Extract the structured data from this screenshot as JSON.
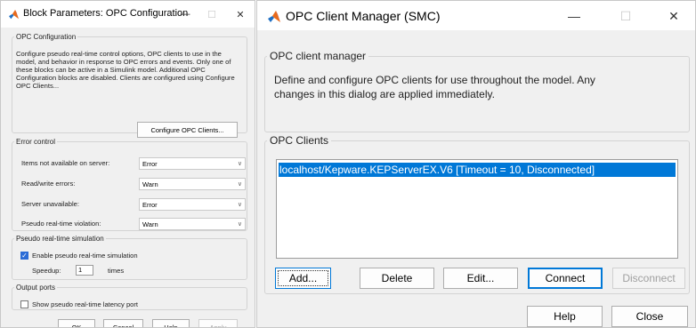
{
  "block_params": {
    "title": "Block Parameters: OPC Configuration",
    "title_controls": {
      "minimize": "—",
      "maximize": "☐",
      "close": "✕"
    },
    "opc_configuration": {
      "legend": "OPC Configuration",
      "description": "Configure pseudo real-time control options, OPC clients to use in the model, and behavior in response to OPC errors and events. Only one of these blocks can be active in a Simulink model. Additional OPC Configuration blocks are disabled. Clients are configured using Configure OPC Clients...",
      "configure_button": "Configure OPC Clients..."
    },
    "error_control": {
      "legend": "Error control",
      "rows": [
        {
          "label": "Items not available on server:",
          "value": "Error"
        },
        {
          "label": "Read/write errors:",
          "value": "Warn"
        },
        {
          "label": "Server unavailable:",
          "value": "Error"
        },
        {
          "label": "Pseudo real-time violation:",
          "value": "Warn"
        }
      ]
    },
    "pseudo_realtime": {
      "legend": "Pseudo real-time simulation",
      "enable_label": "Enable pseudo real-time simulation",
      "enable_checked": true,
      "speedup_label": "Speedup:",
      "speedup_value": "1",
      "speedup_unit": "times"
    },
    "output_ports": {
      "legend": "Output ports",
      "latency_label": "Show pseudo real-time latency port",
      "latency_checked": false
    },
    "buttons": {
      "ok": "OK",
      "cancel": "Cancel",
      "help": "Help",
      "apply": "Apply"
    }
  },
  "client_manager": {
    "title": "OPC Client Manager (SMC)",
    "title_controls": {
      "minimize": "—",
      "maximize": "☐",
      "close": "✕"
    },
    "manager_group": {
      "legend": "OPC client manager",
      "description": "Define and configure OPC clients for use throughout the model. Any changes in this dialog are applied immediately."
    },
    "clients_group": {
      "legend": "OPC Clients",
      "items": [
        "localhost/Kepware.KEPServerEX.V6 [Timeout = 10, Disconnected]"
      ]
    },
    "buttons": {
      "add": "Add...",
      "delete": "Delete",
      "edit": "Edit...",
      "connect": "Connect",
      "disconnect": "Disconnect",
      "help": "Help",
      "close": "Close"
    }
  },
  "colors": {
    "accent": "#0078d7",
    "selection": "#0078d7",
    "window_bg": "#f0f0f0"
  }
}
